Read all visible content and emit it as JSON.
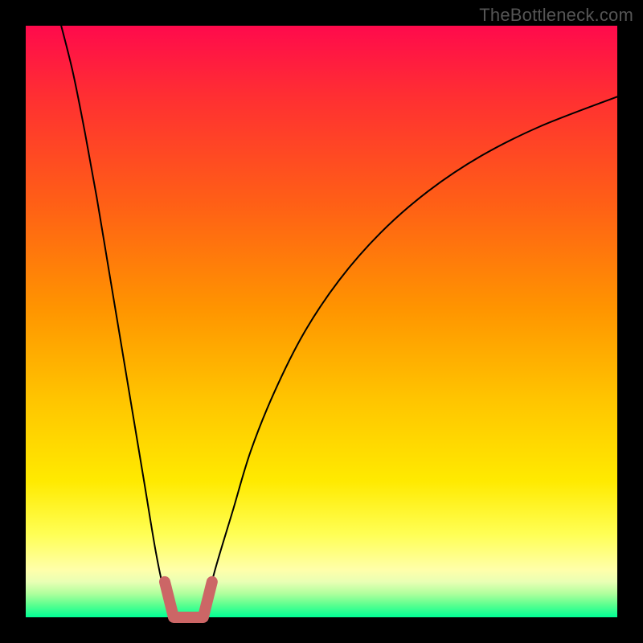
{
  "watermark": "TheBottleneck.com",
  "chart_data": {
    "type": "line",
    "title": "",
    "xlabel": "",
    "ylabel": "",
    "xlim": [
      0,
      100
    ],
    "ylim": [
      0,
      100
    ],
    "grid": false,
    "legend": false,
    "series": [
      {
        "name": "left-curve",
        "x": [
          6,
          8,
          10,
          12,
          14,
          16,
          18,
          20,
          22,
          23.5,
          25
        ],
        "y": [
          100,
          92,
          82,
          71,
          59,
          47,
          35,
          23,
          11,
          4,
          0
        ]
      },
      {
        "name": "right-curve",
        "x": [
          30,
          32,
          35,
          38,
          42,
          47,
          53,
          60,
          68,
          77,
          87,
          100
        ],
        "y": [
          0,
          8,
          18,
          28,
          38,
          48,
          57,
          65,
          72,
          78,
          83,
          88
        ]
      },
      {
        "name": "bottom-bucket",
        "x": [
          23.5,
          25,
          27.5,
          30,
          31.5
        ],
        "y": [
          6,
          0,
          0,
          0,
          6
        ]
      }
    ],
    "colors": {
      "curves": "#000000",
      "bucket": "#cc6666",
      "gradient_top": "#ff0a4c",
      "gradient_bottom": "#00ff95"
    }
  }
}
